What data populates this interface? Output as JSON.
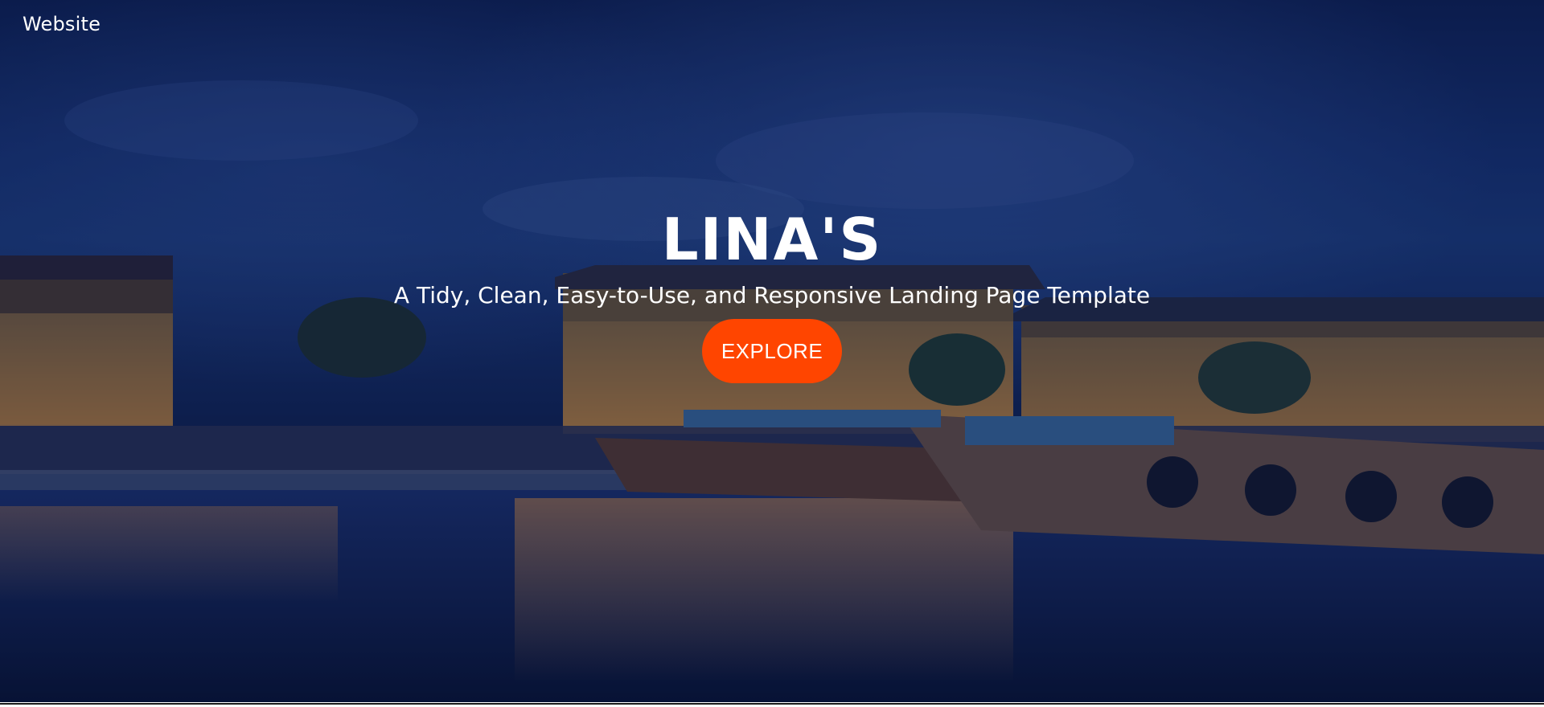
{
  "header": {
    "brand": "Website"
  },
  "hero": {
    "title": "LINA'S",
    "subtitle": "A Tidy, Clean, Easy-to-Use, and Responsive Landing Page Template",
    "cta_label": "EXPLORE"
  },
  "colors": {
    "accent": "#ff4500",
    "overlay": "#0d1f4a",
    "text": "#ffffff"
  }
}
